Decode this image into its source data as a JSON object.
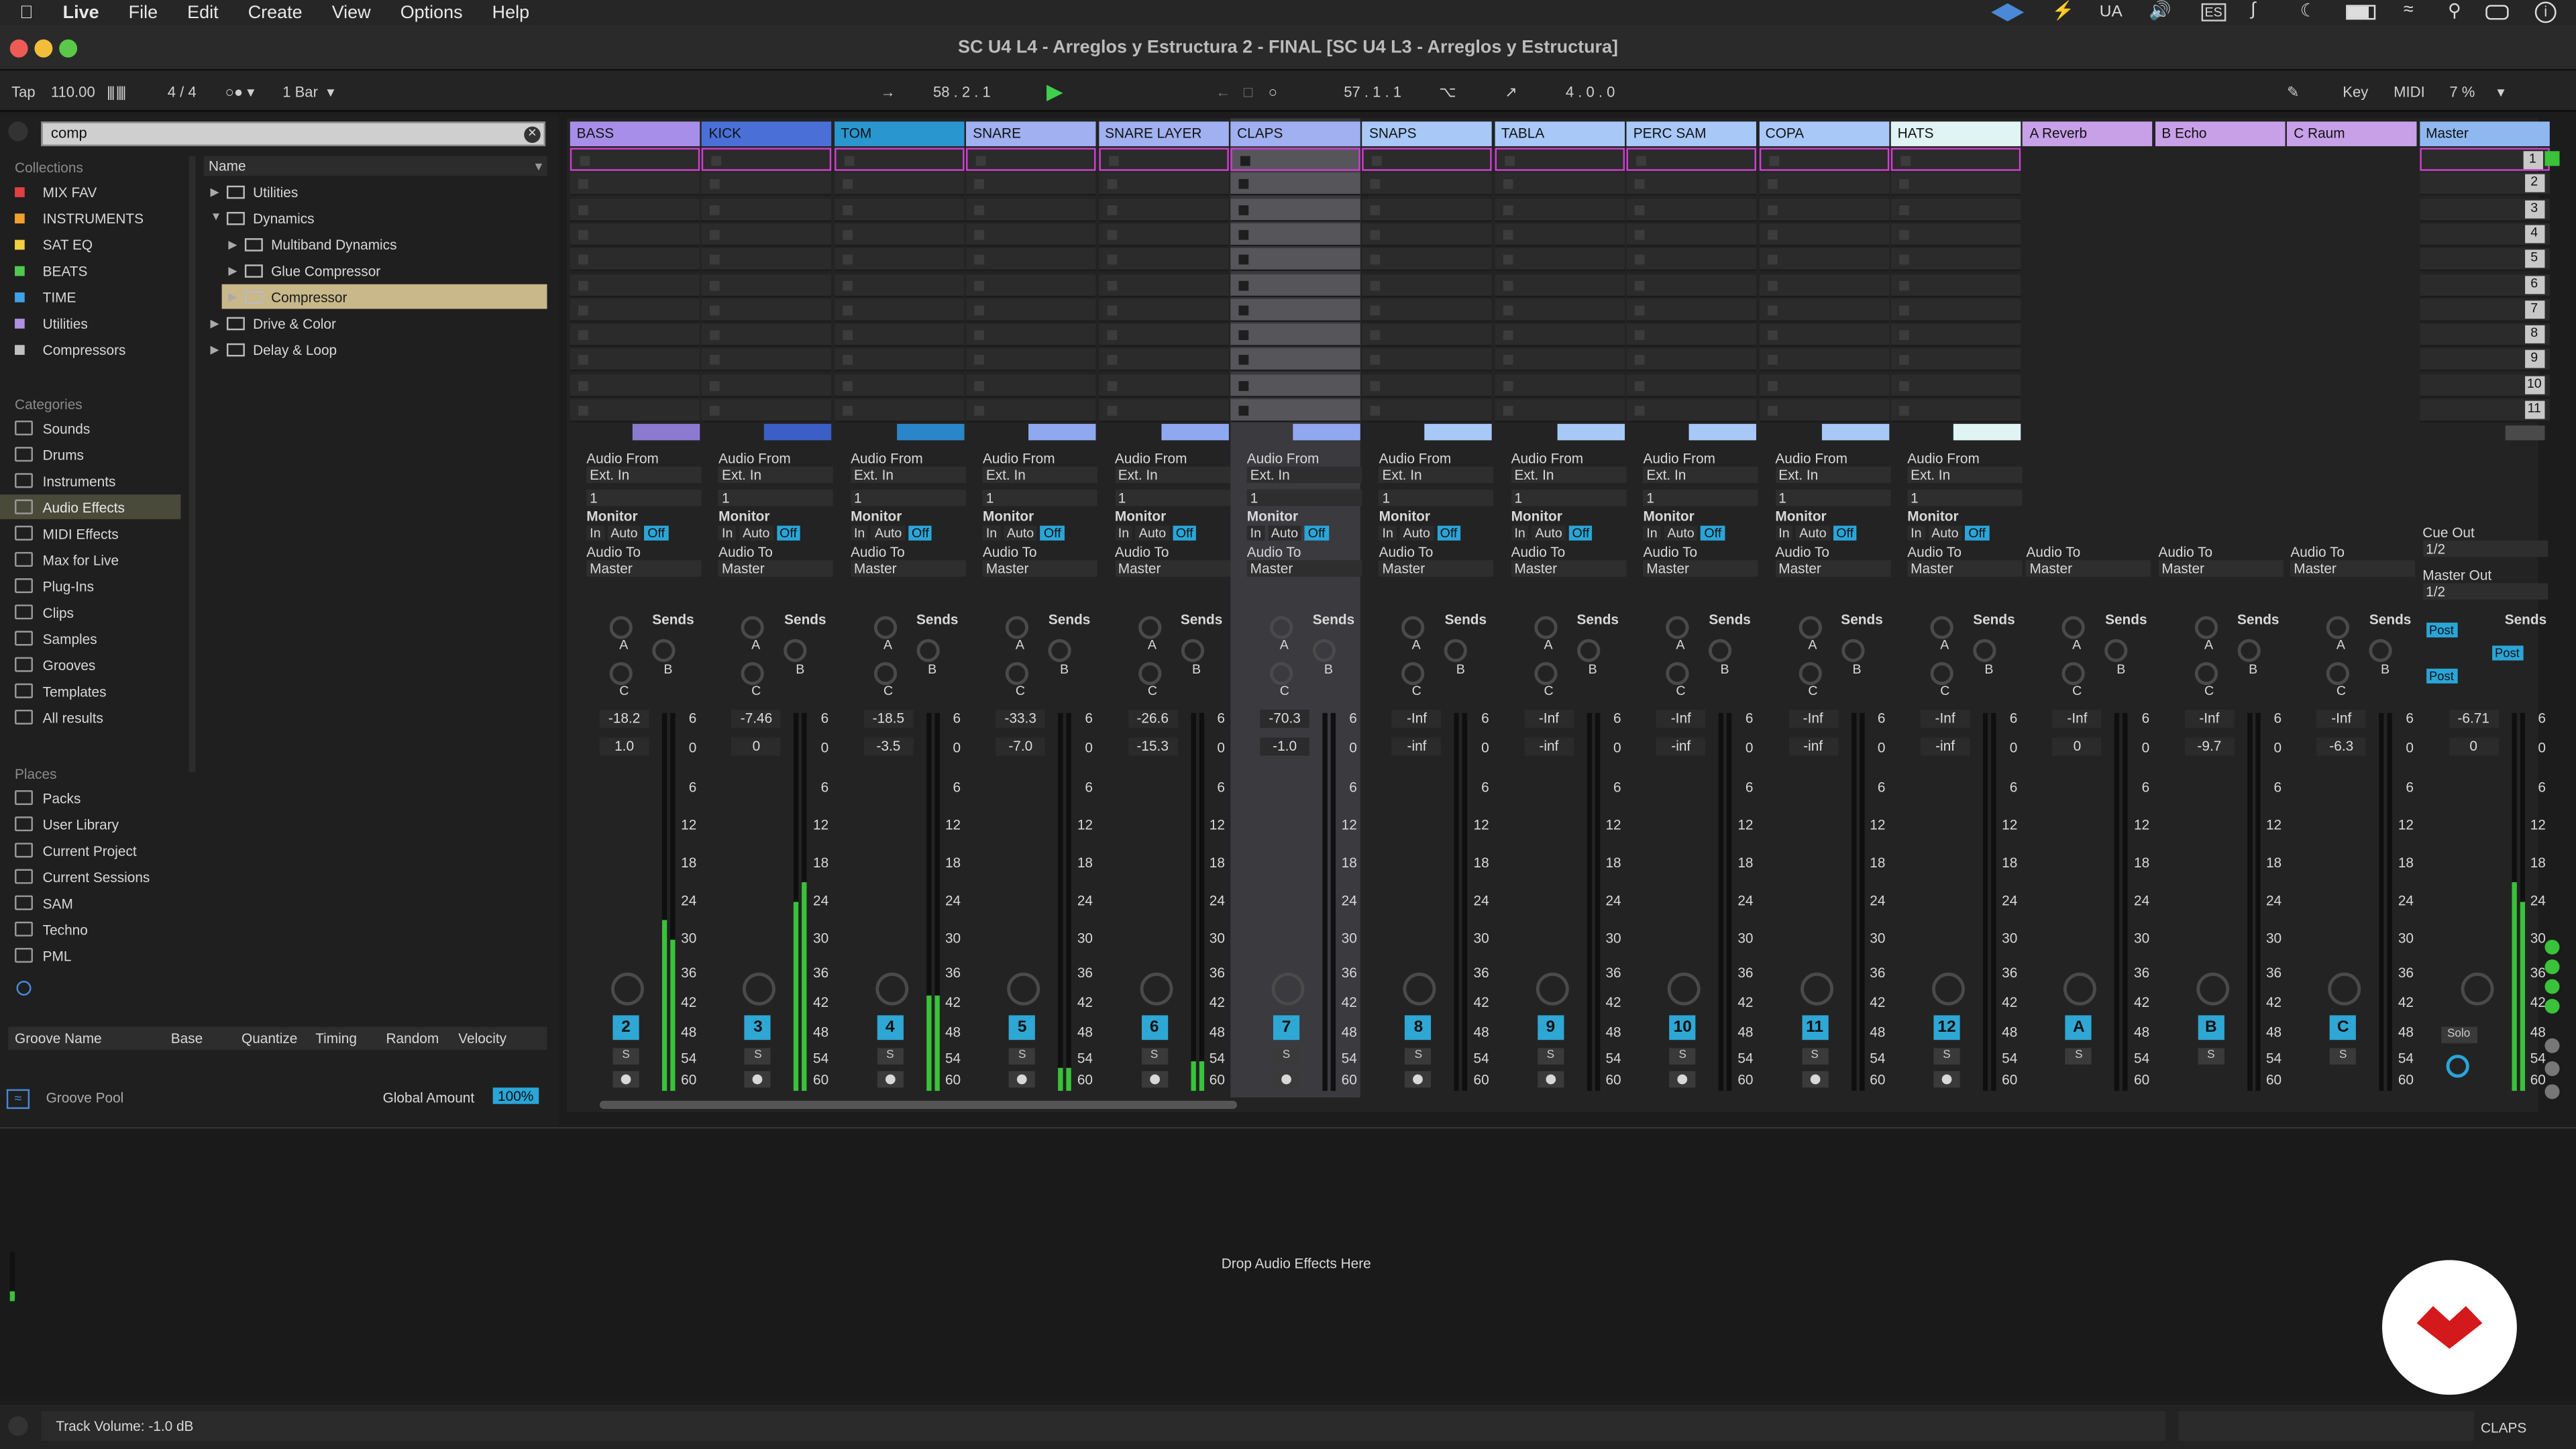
{
  "menubar": {
    "items": [
      "Live",
      "File",
      "Edit",
      "Create",
      "View",
      "Options",
      "Help"
    ],
    "right": [
      "UA",
      "ES"
    ]
  },
  "window": {
    "title": "SC U4 L4 - Arreglos y Estructura 2 - FINAL  [SC U4 L3 - Arreglos y Estructura]"
  },
  "transport": {
    "tap": "Tap",
    "tempo": "110.00",
    "signature": "4 / 4",
    "quantize": "1 Bar",
    "position": "58 .   2 .   1",
    "loop_start": "57 .   1 .   1",
    "loop_length": "4 .   0 .   0",
    "key_label": "Key",
    "midi_label": "MIDI",
    "cpu": "7 %"
  },
  "browser": {
    "search_value": "comp",
    "collections_header": "Collections",
    "collections": [
      {
        "label": "MIX FAV",
        "color": "#e04040"
      },
      {
        "label": "INSTRUMENTS",
        "color": "#f0a030"
      },
      {
        "label": "SAT EQ",
        "color": "#f0d040"
      },
      {
        "label": "BEATS",
        "color": "#50c850"
      },
      {
        "label": "TIME",
        "color": "#40a0e8"
      },
      {
        "label": "Utilities",
        "color": "#b090e0"
      },
      {
        "label": "Compressors",
        "color": "#c0c0c0"
      }
    ],
    "categories_header": "Categories",
    "categories": [
      "Sounds",
      "Drums",
      "Instruments",
      "Audio Effects",
      "MIDI Effects",
      "Max for Live",
      "Plug-Ins",
      "Clips",
      "Samples",
      "Grooves",
      "Templates",
      "All results"
    ],
    "selected_category": "Audio Effects",
    "places_header": "Places",
    "places": [
      "Packs",
      "User Library",
      "Current Project",
      "Current Sessions",
      "SAM",
      "Techno",
      "PML"
    ],
    "column_name": "Name",
    "tree": [
      {
        "label": "Utilities",
        "indent": 0,
        "open": false
      },
      {
        "label": "Dynamics",
        "indent": 0,
        "open": true
      },
      {
        "label": "Multiband Dynamics",
        "indent": 1,
        "open": false
      },
      {
        "label": "Glue Compressor",
        "indent": 1,
        "open": false
      },
      {
        "label": "Compressor",
        "indent": 1,
        "open": false,
        "selected": true
      },
      {
        "label": "Drive & Color",
        "indent": 0,
        "open": false
      },
      {
        "label": "Delay & Loop",
        "indent": 0,
        "open": false
      }
    ],
    "groove_cols": [
      "Groove Name",
      "Base",
      "Quantize",
      "Timing",
      "Random",
      "Velocity"
    ],
    "groove_pool": "Groove Pool",
    "global_amount_label": "Global Amount",
    "global_amount": "100%"
  },
  "tracks": [
    {
      "name": "BASS",
      "color": "#a78ee8",
      "clip": "#8a7ad0",
      "num": "2",
      "vol": "-18.2",
      "pan": "1.0",
      "meter": 0.45,
      "meter2": 0.4
    },
    {
      "name": "KICK",
      "color": "#4a70d8",
      "clip": "#3b5fc6",
      "num": "3",
      "vol": "-7.46",
      "pan": "0",
      "meter": 0.5,
      "meter2": 0.55
    },
    {
      "name": "TOM",
      "color": "#2a96d0",
      "clip": "#2a86c8",
      "num": "4",
      "vol": "-18.5",
      "pan": "-3.5",
      "meter": 0.25,
      "meter2": 0.25
    },
    {
      "name": "SNARE",
      "color": "#a0b0f0",
      "clip": "#90a8f0",
      "num": "5",
      "vol": "-33.3",
      "pan": "-7.0",
      "meter": 0.06,
      "meter2": 0.06
    },
    {
      "name": "SNARE LAYER",
      "color": "#a0b0f0",
      "clip": "#90a8f0",
      "num": "6",
      "vol": "-26.6",
      "pan": "-15.3",
      "meter": 0.08,
      "meter2": 0.08
    },
    {
      "name": "CLAPS",
      "color": "#a0b0f0",
      "clip": "#90a8f0",
      "num": "7",
      "vol": "-70.3",
      "pan": "-1.0",
      "meter": 0,
      "meter2": 0,
      "selected": true
    },
    {
      "name": "SNAPS",
      "color": "#a8c8f8",
      "clip": "#a8c8f8",
      "num": "8",
      "vol": "-Inf",
      "pan": "-inf",
      "meter": 0,
      "meter2": 0
    },
    {
      "name": "TABLA",
      "color": "#a8c8f8",
      "clip": "#a8c8f8",
      "num": "9",
      "vol": "-Inf",
      "pan": "-inf",
      "meter": 0,
      "meter2": 0
    },
    {
      "name": "PERC SAM",
      "color": "#a8c8f8",
      "clip": "#a8c8f8",
      "num": "10",
      "vol": "-Inf",
      "pan": "-inf",
      "meter": 0,
      "meter2": 0
    },
    {
      "name": "COPA",
      "color": "#a8c8f8",
      "clip": "#a8c8f8",
      "num": "11",
      "vol": "-Inf",
      "pan": "-inf",
      "meter": 0,
      "meter2": 0
    },
    {
      "name": "HATS",
      "color": "#e0f4f4",
      "clip": "#e0f4f4",
      "num": "12",
      "vol": "-Inf",
      "pan": "-inf",
      "meter": 0,
      "meter2": 0
    }
  ],
  "returns": [
    {
      "name": "A Reverb",
      "color": "#c8a0e8",
      "num": "A",
      "vol": "-Inf",
      "pan": "0"
    },
    {
      "name": "B Echo",
      "color": "#c8a0e8",
      "num": "B",
      "vol": "-Inf",
      "pan": "-9.7"
    },
    {
      "name": "C Raum",
      "color": "#c8a0e8",
      "num": "C",
      "vol": "-Inf",
      "pan": "-6.3"
    }
  ],
  "master": {
    "name": "Master",
    "color": "#8fb8f0",
    "vol": "-6.71",
    "pan": "0",
    "cue_out": "Cue Out",
    "cue_val": "1/2",
    "master_out": "Master Out",
    "master_val": "1/2",
    "solo": "Solo",
    "post": "Post"
  },
  "labels": {
    "audio_from": "Audio From",
    "ext_in": "Ext. In",
    "channel": "1",
    "monitor": "Monitor",
    "mon_in": "In",
    "mon_auto": "Auto",
    "mon_off": "Off",
    "audio_to": "Audio To",
    "master": "Master",
    "sends": "Sends",
    "A": "A",
    "B": "B",
    "C": "C",
    "S": "S"
  },
  "scenes": [
    "1",
    "2",
    "3",
    "4",
    "5",
    "6",
    "7",
    "8",
    "9",
    "10",
    "11"
  ],
  "meter_scale": [
    "6",
    "0",
    "6",
    "12",
    "18",
    "24",
    "30",
    "36",
    "42",
    "48",
    "54",
    "60"
  ],
  "device_drop": "Drop Audio Effects Here",
  "status": {
    "text": "Track Volume: -1.0 dB",
    "track": "CLAPS"
  }
}
